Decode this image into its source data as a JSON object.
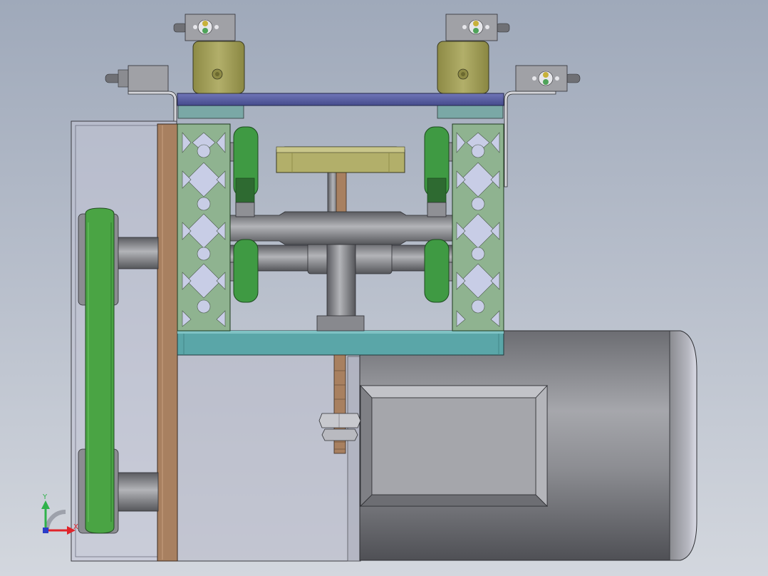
{
  "viewport": {
    "background_top": "#9fa9ba",
    "background_bottom": "#d3d7de"
  },
  "colors": {
    "extrusion": "#8fb390",
    "extrusion_slot": "#c8cde6",
    "wheel": "#3f9a43",
    "belt": "#4aa444",
    "top_plate": "#5a62a6",
    "bottom_plate": "#5aa6a8",
    "bracket_plate": "#9fa1a6",
    "copper": "#a88060",
    "bearing_block": "#a8a562",
    "motor_housing": "#8d8e93",
    "sensor_led_yellow": "#c7b13a",
    "sensor_led_green": "#4fa35a"
  },
  "triad": {
    "x_label": "X",
    "y_label": "Y",
    "x_color": "#e0242a",
    "y_color": "#2fb24a",
    "origin_color": "#2a3cc8"
  }
}
